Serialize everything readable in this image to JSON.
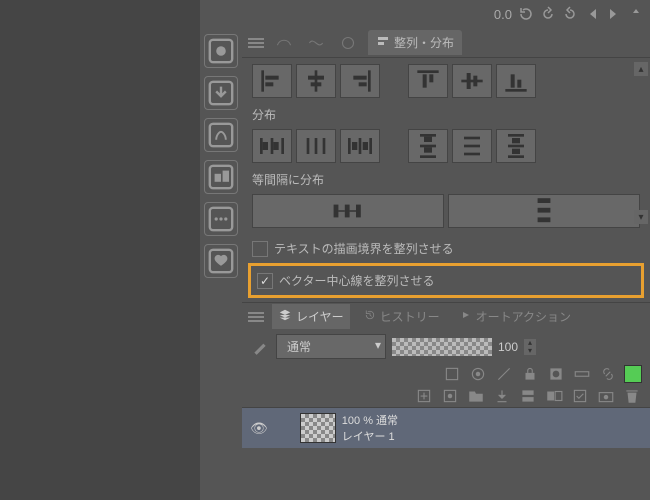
{
  "toolbar": {
    "rotation": "0.0"
  },
  "align_panel": {
    "tab_label": "整列・分布",
    "section_distribute": "分布",
    "section_equal": "等間隔に分布",
    "cb_text_bounds": "テキストの描画境界を整列させる",
    "cb_vector_center": "ベクター中心線を整列させる"
  },
  "layers_panel": {
    "tab_layers": "レイヤー",
    "tab_history": "ヒストリー",
    "tab_autoaction": "オートアクション",
    "blend_mode": "通常",
    "opacity": "100",
    "layer": {
      "opacity_mode": "100 % 通常",
      "name": "レイヤー 1"
    }
  }
}
